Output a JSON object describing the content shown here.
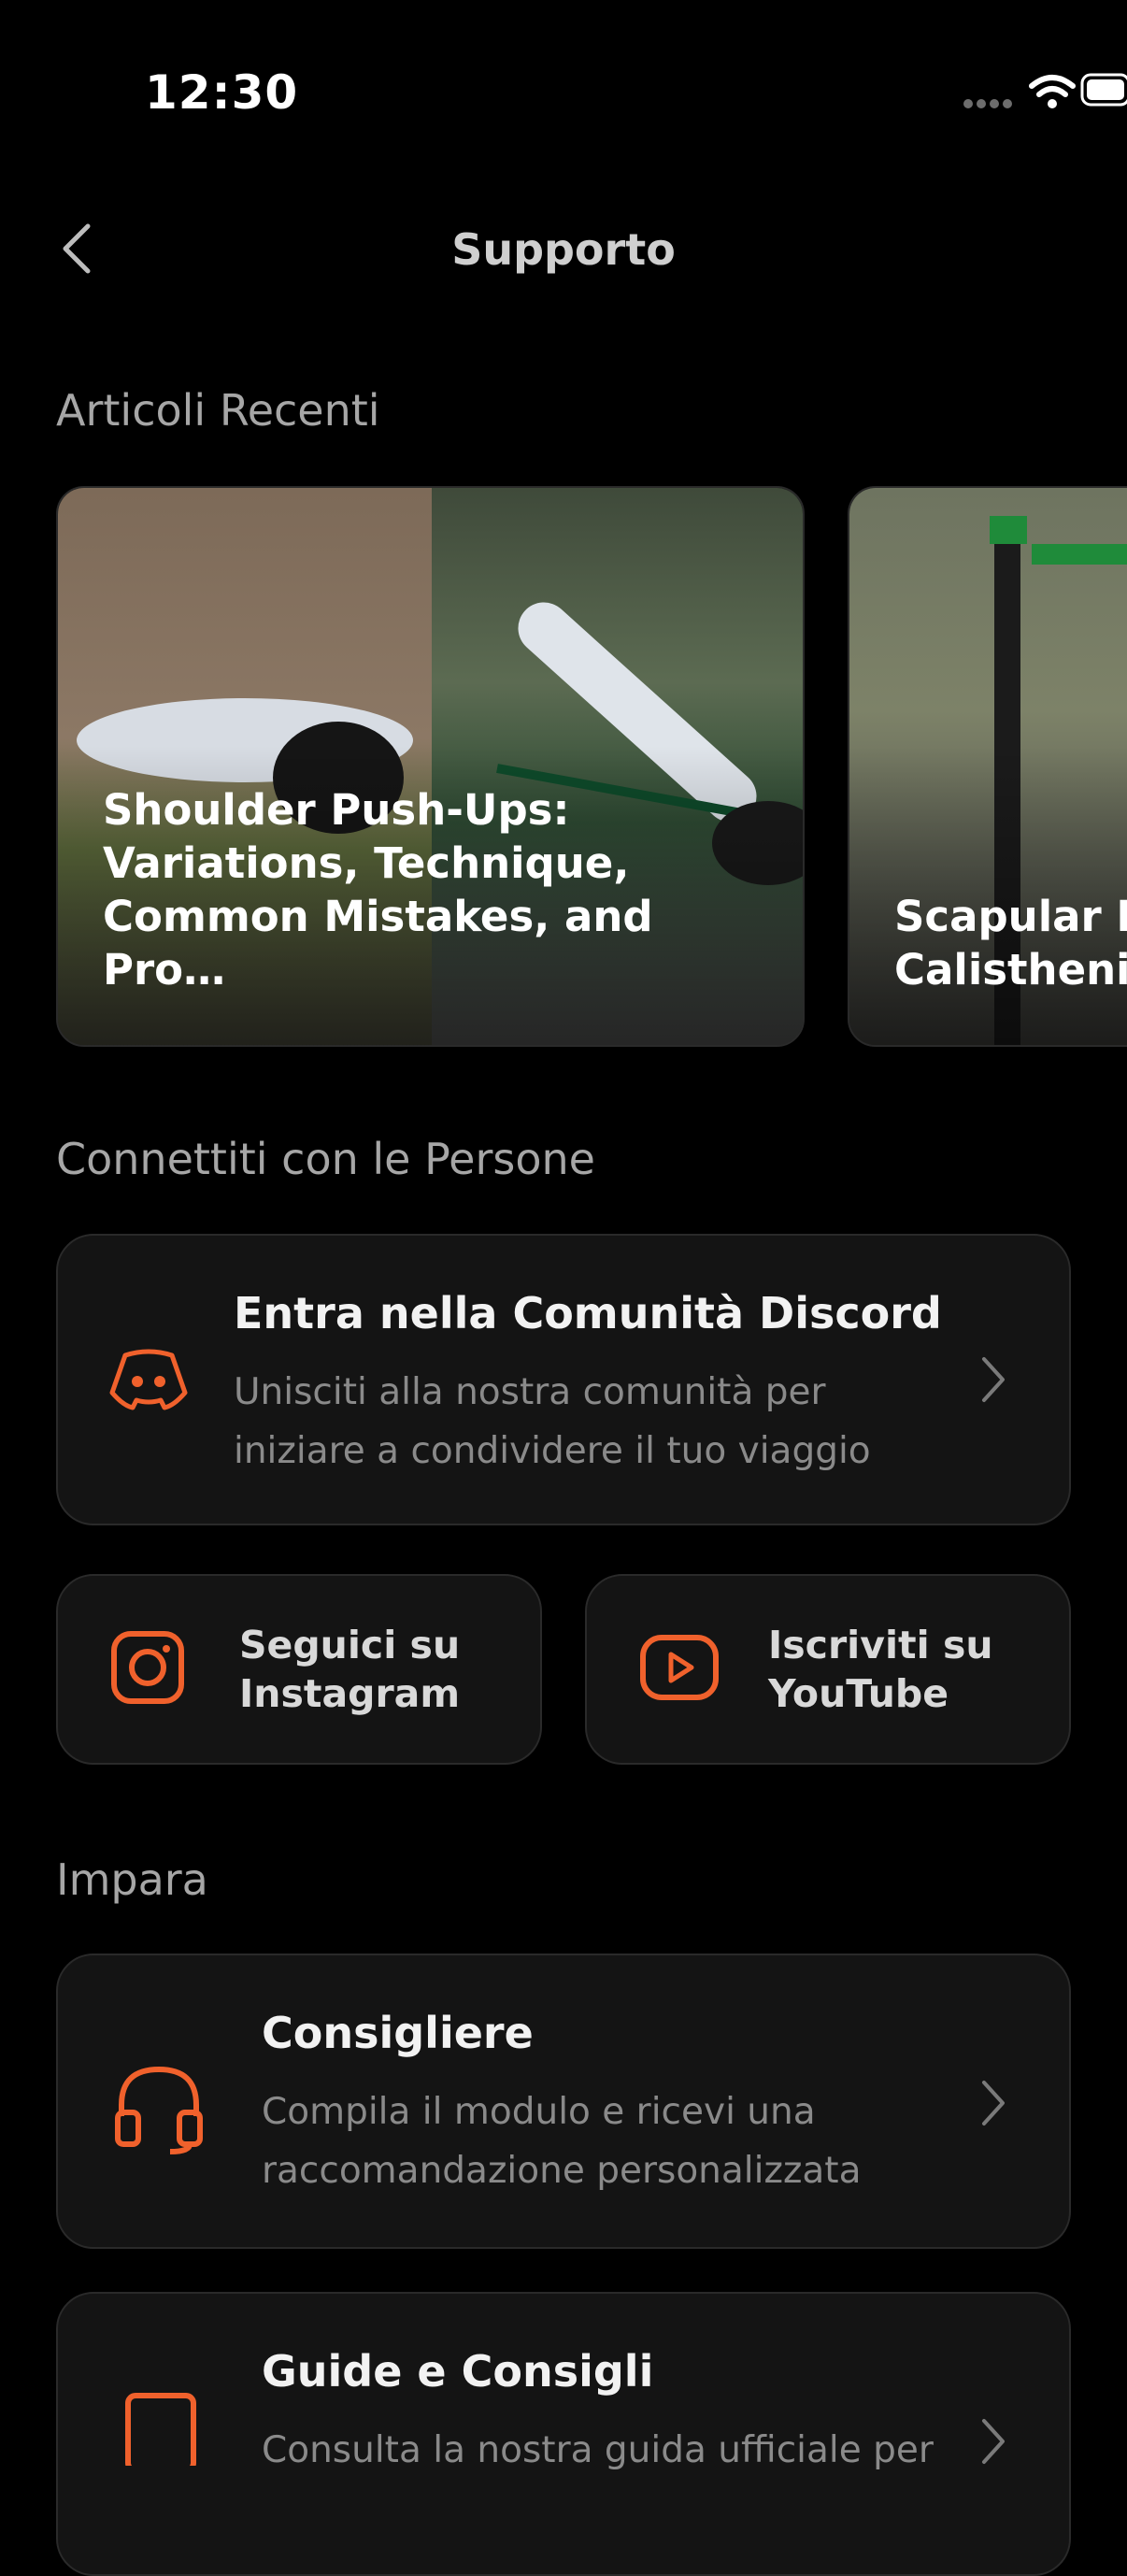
{
  "status_bar": {
    "time": "12:30"
  },
  "header": {
    "title": "Supporto"
  },
  "sections": {
    "recent_articles": "Articoli Recenti",
    "connect": "Connettiti con le Persone",
    "learn": "Impara"
  },
  "articles": [
    {
      "title": "Shoulder Push-Ups:\nVariations, Technique,\nCommon Mistakes, and Pro…"
    },
    {
      "title": "Scapular R\nCalistheni"
    }
  ],
  "discord": {
    "title": "Entra nella Comunità Discord",
    "subtitle_line1": "Unisciti alla nostra comunità per",
    "subtitle_line2": "iniziare a condividere il tuo viaggio"
  },
  "instagram": {
    "label": "Seguici su\nInstagram"
  },
  "youtube": {
    "label": "Iscriviti su\nYouTube"
  },
  "advisor": {
    "title": "Consigliere",
    "subtitle_line1": "Compila il modulo e ricevi una",
    "subtitle_line2": "raccomandazione personalizzata"
  },
  "guides": {
    "title": "Guide e Consigli",
    "subtitle_line1": "Consulta la nostra guida ufficiale per"
  },
  "colors": {
    "accent": "#F0612C",
    "background": "#000000",
    "card": "#141414"
  }
}
